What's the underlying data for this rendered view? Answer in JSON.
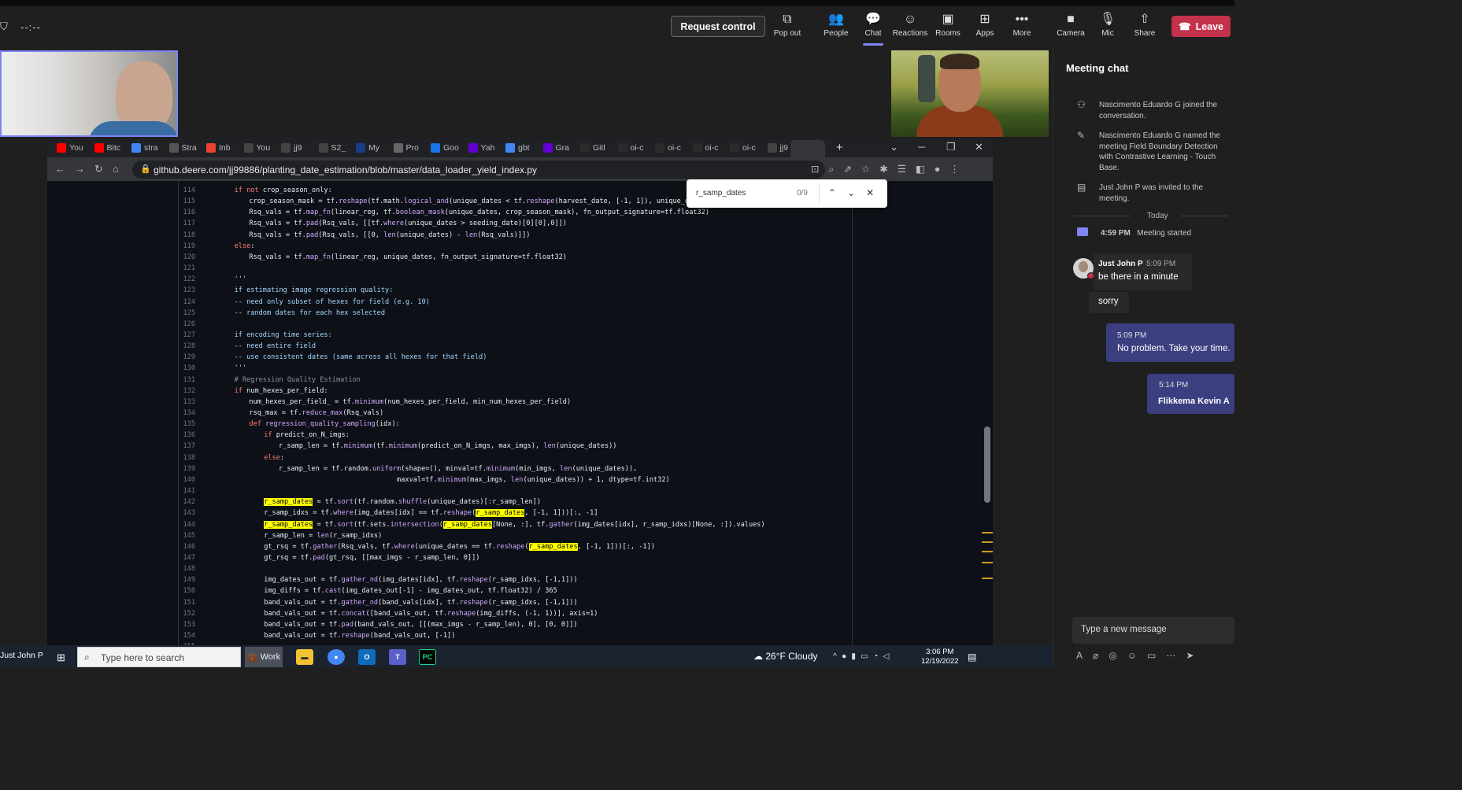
{
  "teams_bar": {
    "timer": "--:--",
    "request_control": "Request control",
    "buttons": [
      {
        "label": "Pop out",
        "icon": "pop-out-icon"
      },
      {
        "label": "People",
        "icon": "people-icon"
      },
      {
        "label": "Chat",
        "icon": "chat-icon"
      },
      {
        "label": "Reactions",
        "icon": "reactions-icon"
      },
      {
        "label": "Rooms",
        "icon": "rooms-icon"
      },
      {
        "label": "Apps",
        "icon": "apps-icon"
      },
      {
        "label": "More",
        "icon": "more-icon"
      },
      {
        "label": "Camera",
        "icon": "camera-icon"
      },
      {
        "label": "Mic",
        "icon": "mic-icon"
      },
      {
        "label": "Share",
        "icon": "share-icon"
      }
    ],
    "leave": "Leave",
    "accent": "#7f85f5",
    "leave_color": "#c4314b"
  },
  "browser": {
    "tabs": [
      {
        "label": "You",
        "icon": "youtube-icon",
        "color": "#ff0000"
      },
      {
        "label": "Bitc",
        "icon": "youtube-icon",
        "color": "#ff0000"
      },
      {
        "label": "stra",
        "icon": "google-icon",
        "color": "#4285f4"
      },
      {
        "label": "Stra",
        "icon": "w-icon",
        "color": "#555555"
      },
      {
        "label": "Inb",
        "icon": "gmail-icon",
        "color": "#ea4335"
      },
      {
        "label": "You",
        "icon": "github-icon",
        "color": "#444444"
      },
      {
        "label": "jj9",
        "icon": "github-icon",
        "color": "#444444"
      },
      {
        "label": "S2_",
        "icon": "github-icon",
        "color": "#444444"
      },
      {
        "label": "My",
        "icon": "circle-icon",
        "color": "#1a3a8a"
      },
      {
        "label": "Pro",
        "icon": "chrome-icon",
        "color": "#666666"
      },
      {
        "label": "Goo",
        "icon": "calendar-icon",
        "color": "#1a73e8"
      },
      {
        "label": "Yah",
        "icon": "yahoo-icon",
        "color": "#6001d2"
      },
      {
        "label": "gbt",
        "icon": "google-icon",
        "color": "#4285f4"
      },
      {
        "label": "Gra",
        "icon": "yahoo-icon",
        "color": "#6001d2"
      },
      {
        "label": "Gitl",
        "icon": "gitlab-icon",
        "color": "#2a2a2a"
      },
      {
        "label": "oi-c",
        "icon": "blank-icon",
        "color": "#2a2a2a"
      },
      {
        "label": "oi-c",
        "icon": "blank-icon",
        "color": "#2a2a2a"
      },
      {
        "label": "oi-c",
        "icon": "blank-icon",
        "color": "#2a2a2a"
      },
      {
        "label": "oi-c",
        "icon": "blank-icon",
        "color": "#2a2a2a"
      },
      {
        "label": "jj9",
        "icon": "github-icon",
        "color": "#444444"
      }
    ],
    "url": "github.deere.com/jj99886/planting_date_estimation/blob/master/data_loader_yield_index.py",
    "find": {
      "query": "r_samp_dates",
      "count": "0/9"
    }
  },
  "code": {
    "line_numbers": [
      "114",
      "115",
      "116",
      "117",
      "118",
      "119",
      "120",
      "121",
      "122",
      "123",
      "124",
      "125",
      "126",
      "127",
      "128",
      "129",
      "130",
      "131",
      "132",
      "133",
      "134",
      "135",
      "136",
      "137",
      "138",
      "139",
      "140",
      "141",
      "142",
      "143",
      "144",
      "145",
      "146",
      "147",
      "148",
      "149",
      "150",
      "151",
      "152",
      "153",
      "154",
      "155"
    ],
    "lines": [
      {
        "indent": 2,
        "segs": [
          {
            "c": "kw",
            "t": "if not "
          },
          {
            "t": "crop_season_only:"
          }
        ]
      },
      {
        "indent": 3,
        "segs": [
          {
            "t": "crop_season_mask = tf."
          },
          {
            "c": "fn",
            "t": "reshape"
          },
          {
            "t": "(tf.math."
          },
          {
            "c": "fn",
            "t": "logical_and"
          },
          {
            "t": "(unique_dates < tf."
          },
          {
            "c": "fn",
            "t": "reshape"
          },
          {
            "t": "(harvest_date, [-1, 1]), unique_dates > tf.r"
          }
        ]
      },
      {
        "indent": 3,
        "segs": [
          {
            "t": "Rsq_vals = tf."
          },
          {
            "c": "fn",
            "t": "map_fn"
          },
          {
            "t": "(linear_reg, tf."
          },
          {
            "c": "fn",
            "t": "boolean_mask"
          },
          {
            "t": "(unique_dates, crop_season_mask), fn_output_signature=tf.float32)"
          }
        ]
      },
      {
        "indent": 3,
        "segs": [
          {
            "t": "Rsq_vals = tf."
          },
          {
            "c": "fn",
            "t": "pad"
          },
          {
            "t": "(Rsq_vals, [[tf."
          },
          {
            "c": "fn",
            "t": "where"
          },
          {
            "t": "(unique_dates > seeding_date)[0][0],0]])"
          }
        ]
      },
      {
        "indent": 3,
        "segs": [
          {
            "t": "Rsq_vals = tf."
          },
          {
            "c": "fn",
            "t": "pad"
          },
          {
            "t": "(Rsq_vals, [[0, "
          },
          {
            "c": "fn",
            "t": "len"
          },
          {
            "t": "(unique_dates) - "
          },
          {
            "c": "fn",
            "t": "len"
          },
          {
            "t": "(Rsq_vals)]])"
          }
        ]
      },
      {
        "indent": 2,
        "segs": [
          {
            "c": "kw",
            "t": "else"
          },
          {
            "t": ":"
          }
        ]
      },
      {
        "indent": 3,
        "segs": [
          {
            "t": "Rsq_vals = tf."
          },
          {
            "c": "fn",
            "t": "map_fn"
          },
          {
            "t": "(linear_reg, unique_dates, fn_output_signature=tf.float32)"
          }
        ]
      },
      {
        "indent": 0,
        "segs": []
      },
      {
        "indent": 2,
        "segs": [
          {
            "c": "str",
            "t": "'''"
          }
        ]
      },
      {
        "indent": 2,
        "segs": [
          {
            "c": "str",
            "t": "if estimating image regression quality:"
          }
        ]
      },
      {
        "indent": 2,
        "segs": [
          {
            "c": "str",
            "t": "-- need only subset of hexes for field (e.g. 10)"
          }
        ]
      },
      {
        "indent": 2,
        "segs": [
          {
            "c": "str",
            "t": "-- random dates for each hex selected"
          }
        ]
      },
      {
        "indent": 0,
        "segs": []
      },
      {
        "indent": 2,
        "segs": [
          {
            "c": "str",
            "t": "if encoding time series:"
          }
        ]
      },
      {
        "indent": 2,
        "segs": [
          {
            "c": "str",
            "t": "-- need entire field"
          }
        ]
      },
      {
        "indent": 2,
        "segs": [
          {
            "c": "str",
            "t": "-- use consistent dates (same across all hexes for that field)"
          }
        ]
      },
      {
        "indent": 2,
        "segs": [
          {
            "c": "str",
            "t": "'''"
          }
        ]
      },
      {
        "indent": 2,
        "segs": [
          {
            "c": "cm",
            "t": "# Regression Quality Estimation"
          }
        ]
      },
      {
        "indent": 2,
        "segs": [
          {
            "c": "kw",
            "t": "if "
          },
          {
            "t": "num_hexes_per_field:"
          }
        ]
      },
      {
        "indent": 3,
        "segs": [
          {
            "t": "num_hexes_per_field_ = tf."
          },
          {
            "c": "fn",
            "t": "minimum"
          },
          {
            "t": "(num_hexes_per_field, min_num_hexes_per_field)"
          }
        ]
      },
      {
        "indent": 3,
        "segs": [
          {
            "t": "rsq_max = tf."
          },
          {
            "c": "fn",
            "t": "reduce_max"
          },
          {
            "t": "(Rsq_vals)"
          }
        ]
      },
      {
        "indent": 3,
        "segs": [
          {
            "c": "kw",
            "t": "def "
          },
          {
            "c": "fn",
            "t": "regression_quality_sampling"
          },
          {
            "t": "(idx):"
          }
        ]
      },
      {
        "indent": 4,
        "segs": [
          {
            "c": "kw",
            "t": "if "
          },
          {
            "t": "predict_on_N_imgs:"
          }
        ]
      },
      {
        "indent": 5,
        "segs": [
          {
            "t": "r_samp_len = tf."
          },
          {
            "c": "fn",
            "t": "minimum"
          },
          {
            "t": "(tf."
          },
          {
            "c": "fn",
            "t": "minimum"
          },
          {
            "t": "(predict_on_N_imgs, max_imgs), "
          },
          {
            "c": "fn",
            "t": "len"
          },
          {
            "t": "(unique_dates))"
          }
        ]
      },
      {
        "indent": 4,
        "segs": [
          {
            "c": "kw",
            "t": "else"
          },
          {
            "t": ":"
          }
        ]
      },
      {
        "indent": 5,
        "segs": [
          {
            "t": "r_samp_len = tf.random."
          },
          {
            "c": "fn",
            "t": "uniform"
          },
          {
            "t": "(shape=(), minval=tf."
          },
          {
            "c": "fn",
            "t": "minimum"
          },
          {
            "t": "(min_imgs, "
          },
          {
            "c": "fn",
            "t": "len"
          },
          {
            "t": "(unique_dates)),"
          }
        ]
      },
      {
        "indent": 5,
        "segs": [
          {
            "t": "                             maxval=tf."
          },
          {
            "c": "fn",
            "t": "minimum"
          },
          {
            "t": "(max_imgs, "
          },
          {
            "c": "fn",
            "t": "len"
          },
          {
            "t": "(unique_dates)) + 1, dtype=tf.int32)"
          }
        ]
      },
      {
        "indent": 0,
        "segs": []
      },
      {
        "indent": 4,
        "segs": [
          {
            "c": "hl",
            "t": "r_samp_dates"
          },
          {
            "t": " = tf."
          },
          {
            "c": "fn",
            "t": "sort"
          },
          {
            "t": "(tf.random."
          },
          {
            "c": "fn",
            "t": "shuffle"
          },
          {
            "t": "(unique_dates)[:r_samp_len])"
          }
        ]
      },
      {
        "indent": 4,
        "segs": [
          {
            "t": "r_samp_idxs = tf."
          },
          {
            "c": "fn",
            "t": "where"
          },
          {
            "t": "(img_dates[idx] == tf."
          },
          {
            "c": "fn",
            "t": "reshape"
          },
          {
            "t": "("
          },
          {
            "c": "hl",
            "t": "r_samp_dates"
          },
          {
            "t": ", [-1, 1]))[:, -1]"
          }
        ]
      },
      {
        "indent": 4,
        "segs": [
          {
            "c": "hl",
            "t": "r_samp_dates"
          },
          {
            "t": " = tf."
          },
          {
            "c": "fn",
            "t": "sort"
          },
          {
            "t": "(tf.sets."
          },
          {
            "c": "fn",
            "t": "intersection"
          },
          {
            "t": "("
          },
          {
            "c": "hl",
            "t": "r_samp_dates"
          },
          {
            "t": "[None, :], tf."
          },
          {
            "c": "fn",
            "t": "gather"
          },
          {
            "t": "(img_dates[idx], r_samp_idxs)[None, :]).values)"
          }
        ]
      },
      {
        "indent": 4,
        "segs": [
          {
            "t": "r_samp_len = "
          },
          {
            "c": "fn",
            "t": "len"
          },
          {
            "t": "(r_samp_idxs)"
          }
        ]
      },
      {
        "indent": 4,
        "segs": [
          {
            "t": "gt_rsq = tf."
          },
          {
            "c": "fn",
            "t": "gather"
          },
          {
            "t": "(Rsq_vals, tf."
          },
          {
            "c": "fn",
            "t": "where"
          },
          {
            "t": "(unique_dates == tf."
          },
          {
            "c": "fn",
            "t": "reshape"
          },
          {
            "t": "("
          },
          {
            "c": "hl",
            "t": "r_samp_dates"
          },
          {
            "t": ", [-1, 1]))[:, -1])"
          }
        ]
      },
      {
        "indent": 4,
        "segs": [
          {
            "t": "gt_rsq = tf."
          },
          {
            "c": "fn",
            "t": "pad"
          },
          {
            "t": "(gt_rsq, [[max_imgs - r_samp_len, 0]])"
          }
        ]
      },
      {
        "indent": 0,
        "segs": []
      },
      {
        "indent": 4,
        "segs": [
          {
            "t": "img_dates_out = tf."
          },
          {
            "c": "fn",
            "t": "gather_nd"
          },
          {
            "t": "(img_dates[idx], tf."
          },
          {
            "c": "fn",
            "t": "reshape"
          },
          {
            "t": "(r_samp_idxs, [-1,1]))"
          }
        ]
      },
      {
        "indent": 4,
        "segs": [
          {
            "t": "img_diffs = tf."
          },
          {
            "c": "fn",
            "t": "cast"
          },
          {
            "t": "(img_dates_out[-1] - img_dates_out, tf.float32) / 365"
          }
        ]
      },
      {
        "indent": 4,
        "segs": [
          {
            "t": "band_vals_out = tf."
          },
          {
            "c": "fn",
            "t": "gather_nd"
          },
          {
            "t": "(band_vals[idx], tf."
          },
          {
            "c": "fn",
            "t": "reshape"
          },
          {
            "t": "(r_samp_idxs, [-1,1]))"
          }
        ]
      },
      {
        "indent": 4,
        "segs": [
          {
            "t": "band_vals_out = tf."
          },
          {
            "c": "fn",
            "t": "concat"
          },
          {
            "t": "([band_vals_out, tf."
          },
          {
            "c": "fn",
            "t": "reshape"
          },
          {
            "t": "(img_diffs, (-1, 1))], axis=1)"
          }
        ]
      },
      {
        "indent": 4,
        "segs": [
          {
            "t": "band_vals_out = tf."
          },
          {
            "c": "fn",
            "t": "pad"
          },
          {
            "t": "(band_vals_out, [[(max_imgs - r_samp_len), 0], [0, 0]])"
          }
        ]
      },
      {
        "indent": 4,
        "segs": [
          {
            "t": "band_vals_out = tf."
          },
          {
            "c": "fn",
            "t": "reshape"
          },
          {
            "t": "(band_vals_out, [-1])"
          }
        ]
      },
      {
        "indent": 0,
        "segs": []
      }
    ]
  },
  "chat": {
    "title": "Meeting chat",
    "events": [
      {
        "icon": "person-add-icon",
        "text": "Nascimento Eduardo G joined the conversation."
      },
      {
        "icon": "pencil-icon",
        "text": "Nascimento Eduardo G named the meeting Field Boundary Detection with Contrastive Learning - Touch Base."
      },
      {
        "icon": "calendar-person-icon",
        "text": "Just John P was invited to the meeting."
      }
    ],
    "today": "Today",
    "meeting_started": {
      "time": "4:59 PM",
      "label": "Meeting started"
    },
    "messages": [
      {
        "sender": "Just John P",
        "time": "5:09 PM",
        "text": "be there in a minute"
      },
      {
        "text": "sorry"
      },
      {
        "time": "5:09 PM",
        "text": "No problem. Take your time."
      },
      {
        "time": "5:14 PM",
        "text": "Flikkema Kevin A"
      }
    ],
    "compose_placeholder": "Type a new message"
  },
  "taskbar": {
    "user_label": "Just John P",
    "search_placeholder": "Type here to search",
    "work_label": "Work",
    "apps": [
      {
        "name": "file-explorer-icon",
        "color": "#f2c233"
      },
      {
        "name": "chrome-icon",
        "color": "#4285f4"
      },
      {
        "name": "outlook-icon",
        "color": "#0f6cbd"
      },
      {
        "name": "teams-icon",
        "color": "#5b5fc7"
      },
      {
        "name": "pycharm-icon",
        "color": "#21d789"
      }
    ],
    "weather": "26°F  Cloudy",
    "time": "3:06 PM",
    "date": "12/19/2022"
  }
}
